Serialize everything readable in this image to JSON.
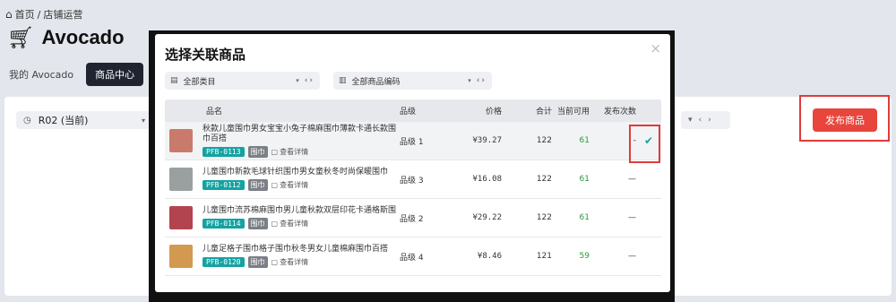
{
  "breadcrumb": {
    "home": "首页",
    "separator": "/",
    "current": "店铺运营"
  },
  "page_title": "Avocado",
  "tabs": [
    {
      "label": "我的 Avocado",
      "active": false
    },
    {
      "label": "商品中心",
      "active": true
    }
  ],
  "round_select": {
    "value": "R02 (当前)"
  },
  "publish_button": "发布商品",
  "modal": {
    "title": "选择关联商品",
    "close": "×",
    "filter_category": "全部类目",
    "filter_code": "全部商品编码",
    "columns": [
      "品名",
      "品级",
      "价格",
      "合计",
      "当前可用",
      "发布次数"
    ],
    "rows": [
      {
        "name": "秋款儿童围巾男女宝宝小兔子棉麻围巾薄款卡通长款围巾百搭",
        "code": "PFB-0113",
        "category": "围巾",
        "detail": "查看详情",
        "level": "品级 1",
        "price": "¥39.27",
        "total": "122",
        "available": "61",
        "count": "-",
        "selected": true,
        "thumb_color": "#c97a6a"
      },
      {
        "name": "儿童围巾新款毛球针织围巾男女童秋冬时尚保暖围巾",
        "code": "PFB-0112",
        "category": "围巾",
        "detail": "查看详情",
        "level": "品级 3",
        "price": "¥16.08",
        "total": "122",
        "available": "61",
        "count": "—",
        "selected": false,
        "thumb_color": "#9aa0a0"
      },
      {
        "name": "儿童围巾流苏棉麻围巾男儿童秋款双层印花卡通格斯围",
        "code": "PFB-0114",
        "category": "围巾",
        "detail": "查看详情",
        "level": "品级 2",
        "price": "¥29.22",
        "total": "122",
        "available": "61",
        "count": "—",
        "selected": false,
        "thumb_color": "#b24450"
      },
      {
        "name": "儿童足格子围巾格子围巾秋冬男女儿童棉麻围巾百搭",
        "code": "PFB-0120",
        "category": "围巾",
        "detail": "查看详情",
        "level": "品级 4",
        "price": "¥8.46",
        "total": "121",
        "available": "59",
        "count": "—",
        "selected": false,
        "thumb_color": "#d29a4e"
      }
    ]
  },
  "colors": {
    "accent_red": "#e8453c",
    "teal": "#15a2a2",
    "green": "#2a9b3c",
    "dark": "#1f2430"
  },
  "icons": {
    "home": "home-icon",
    "cart": "cart-icon",
    "clock": "clock-icon",
    "category": "box-icon",
    "barcode": "barcode-icon",
    "check": "check-icon",
    "detail": "document-icon"
  }
}
